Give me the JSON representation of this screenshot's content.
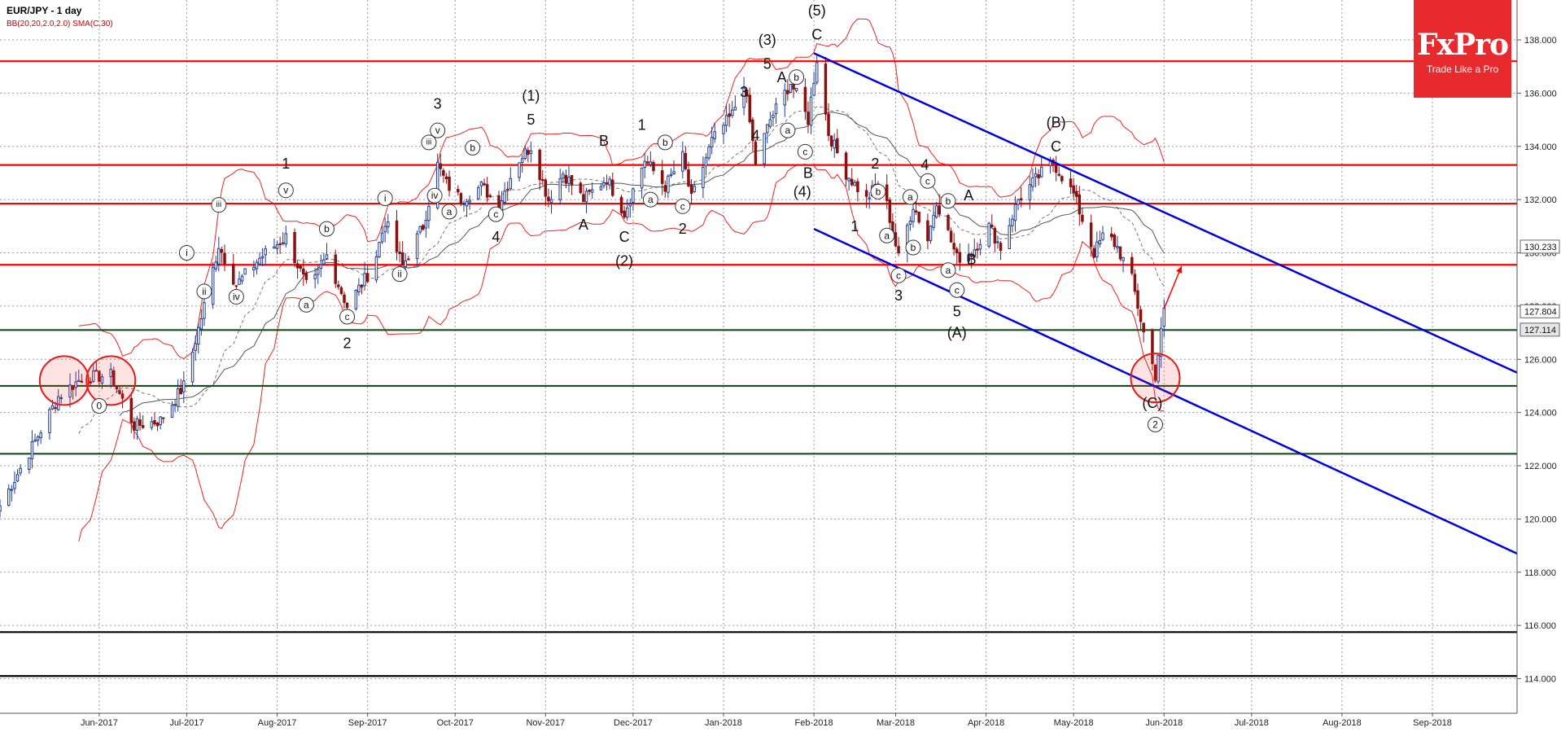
{
  "header": {
    "title": "EUR/JPY - 1 day",
    "indicators": "BB(20,20,2.0,2.0) SMA(C,30)"
  },
  "brand": {
    "name": "FxPro",
    "tagline": "Trade Like a Pro"
  },
  "chart_data": {
    "type": "candlestick",
    "symbol": "EUR/JPY",
    "timeframe": "1 day",
    "ylim": [
      112.7,
      139.5
    ],
    "y_ticks": [
      114,
      116,
      118,
      120,
      122,
      124,
      126,
      128,
      130,
      132,
      134,
      136,
      138
    ],
    "y_tick_labels": [
      "114.000",
      "116.000",
      "118.000",
      "120.000",
      "122.000",
      "124.000",
      "126.000",
      "128.000",
      "130.000",
      "132.000",
      "134.000",
      "136.000",
      "138.000"
    ],
    "x_range": [
      "2017-04-28",
      "2018-09-30"
    ],
    "x_ticks": [
      {
        "date": "2017-06-01",
        "label": "Jun-2017"
      },
      {
        "date": "2017-07-01",
        "label": "Jul-2017"
      },
      {
        "date": "2017-08-01",
        "label": "Aug-2017"
      },
      {
        "date": "2017-09-01",
        "label": "Sep-2017"
      },
      {
        "date": "2017-10-01",
        "label": "Oct-2017"
      },
      {
        "date": "2017-11-01",
        "label": "Nov-2017"
      },
      {
        "date": "2017-12-01",
        "label": "Dec-2017"
      },
      {
        "date": "2018-01-01",
        "label": "Jan-2018"
      },
      {
        "date": "2018-02-01",
        "label": "Feb-2018"
      },
      {
        "date": "2018-03-01",
        "label": "Mar-2018"
      },
      {
        "date": "2018-04-01",
        "label": "Apr-2018"
      },
      {
        "date": "2018-05-01",
        "label": "May-2018"
      },
      {
        "date": "2018-06-01",
        "label": "Jun-2018"
      },
      {
        "date": "2018-07-01",
        "label": "Jul-2018"
      },
      {
        "date": "2018-08-01",
        "label": "Aug-2018"
      },
      {
        "date": "2018-09-01",
        "label": "Sep-2018"
      }
    ],
    "price_labels": [
      {
        "value": 130.233,
        "label": "130.233",
        "color": "#ffffff"
      },
      {
        "value": 127.804,
        "label": "127.804",
        "color": "#ffffff"
      },
      {
        "value": 127.114,
        "label": "127.114",
        "color": "#e6e6e6"
      }
    ],
    "horizontal_levels": [
      {
        "value": 137.2,
        "color": "#ff0000"
      },
      {
        "value": 133.3,
        "color": "#ff0000"
      },
      {
        "value": 131.85,
        "color": "#ff0000"
      },
      {
        "value": 129.55,
        "color": "#ff0000"
      },
      {
        "value": 127.1,
        "color": "#1a4d1a"
      },
      {
        "value": 125.0,
        "color": "#1a4d1a"
      },
      {
        "value": 122.45,
        "color": "#1a4d1a"
      },
      {
        "value": 115.75,
        "color": "#000000"
      },
      {
        "value": 114.1,
        "color": "#000000"
      }
    ],
    "channel_lines": [
      {
        "from": {
          "date": "2018-02-01",
          "value": 137.5
        },
        "to": {
          "date": "2018-09-30",
          "value": 125.5
        },
        "color": "#0000dd"
      },
      {
        "from": {
          "date": "2018-02-01",
          "value": 130.9
        },
        "to": {
          "date": "2018-09-30",
          "value": 118.7
        },
        "color": "#0000dd"
      }
    ],
    "highlight_circles": [
      {
        "date": "2017-05-20",
        "value": 125.2
      },
      {
        "date": "2017-06-05",
        "value": 125.2
      },
      {
        "date": "2018-05-29",
        "value": 125.3
      }
    ],
    "projection_arrow": {
      "from": {
        "date": "2018-06-01",
        "value": 127.9
      },
      "to": {
        "date": "2018-06-07",
        "value": 129.5
      }
    },
    "price_anchors": [
      [
        "2017-04-28",
        120.5
      ],
      [
        "2017-05-08",
        122.5
      ],
      [
        "2017-05-18",
        124.6
      ],
      [
        "2017-05-26",
        125.3
      ],
      [
        "2017-06-05",
        125.4
      ],
      [
        "2017-06-13",
        123.5
      ],
      [
        "2017-06-22",
        123.7
      ],
      [
        "2017-06-30",
        125.0
      ],
      [
        "2017-07-07",
        128.0
      ],
      [
        "2017-07-12",
        130.3
      ],
      [
        "2017-07-18",
        128.8
      ],
      [
        "2017-07-26",
        129.8
      ],
      [
        "2017-08-04",
        130.6
      ],
      [
        "2017-08-12",
        128.5
      ],
      [
        "2017-08-18",
        129.9
      ],
      [
        "2017-08-25",
        128.0
      ],
      [
        "2017-09-03",
        129.5
      ],
      [
        "2017-09-07",
        131.2
      ],
      [
        "2017-09-13",
        129.5
      ],
      [
        "2017-09-20",
        131.0
      ],
      [
        "2017-09-25",
        133.3
      ],
      [
        "2017-09-28",
        132.6
      ],
      [
        "2017-10-03",
        132.0
      ],
      [
        "2017-10-10",
        132.5
      ],
      [
        "2017-10-16",
        131.8
      ],
      [
        "2017-10-22",
        133.4
      ],
      [
        "2017-10-27",
        134.0
      ],
      [
        "2017-11-02",
        132.0
      ],
      [
        "2017-11-07",
        133.0
      ],
      [
        "2017-11-14",
        132.0
      ],
      [
        "2017-11-22",
        132.8
      ],
      [
        "2017-11-28",
        131.5
      ],
      [
        "2017-12-05",
        133.5
      ],
      [
        "2017-12-12",
        132.5
      ],
      [
        "2017-12-18",
        133.6
      ],
      [
        "2017-12-21",
        132.0
      ],
      [
        "2017-12-28",
        134.2
      ],
      [
        "2018-01-04",
        135.2
      ],
      [
        "2018-01-08",
        136.4
      ],
      [
        "2018-01-12",
        133.4
      ],
      [
        "2018-01-17",
        135.0
      ],
      [
        "2018-01-24",
        136.4
      ],
      [
        "2018-01-30",
        135.0
      ],
      [
        "2018-02-02",
        137.3
      ],
      [
        "2018-02-06",
        134.5
      ],
      [
        "2018-02-12",
        133.0
      ],
      [
        "2018-02-19",
        132.0
      ],
      [
        "2018-02-24",
        132.8
      ],
      [
        "2018-03-02",
        129.8
      ],
      [
        "2018-03-07",
        131.8
      ],
      [
        "2018-03-12",
        130.5
      ],
      [
        "2018-03-15",
        132.0
      ],
      [
        "2018-03-22",
        129.8
      ],
      [
        "2018-03-27",
        130.0
      ],
      [
        "2018-04-02",
        131.0
      ],
      [
        "2018-04-06",
        130.2
      ],
      [
        "2018-04-12",
        132.0
      ],
      [
        "2018-04-20",
        133.0
      ],
      [
        "2018-04-24",
        133.4
      ],
      [
        "2018-05-01",
        132.2
      ],
      [
        "2018-05-08",
        130.0
      ],
      [
        "2018-05-12",
        130.8
      ],
      [
        "2018-05-16",
        130.2
      ],
      [
        "2018-05-21",
        129.0
      ],
      [
        "2018-05-25",
        127.0
      ],
      [
        "2018-05-29",
        125.4
      ],
      [
        "2018-06-01",
        127.8
      ]
    ],
    "wave_labels": [
      {
        "date": "2017-06-01",
        "value": 124.25,
        "text": "0",
        "circled": true
      },
      {
        "date": "2017-07-01",
        "value": 130.0,
        "text": "i",
        "circled": true
      },
      {
        "date": "2017-07-07",
        "value": 128.55,
        "text": "ii",
        "circled": true
      },
      {
        "date": "2017-07-12",
        "value": 131.8,
        "text": "iii",
        "circled": true
      },
      {
        "date": "2017-07-18",
        "value": 128.35,
        "text": "iv",
        "circled": true
      },
      {
        "date": "2017-08-04",
        "value": 132.35,
        "text": "v",
        "circled": true
      },
      {
        "date": "2017-08-04",
        "value": 133.35,
        "text": "1",
        "circled": false
      },
      {
        "date": "2017-08-11",
        "value": 128.05,
        "text": "a",
        "circled": true
      },
      {
        "date": "2017-08-18",
        "value": 130.9,
        "text": "b",
        "circled": true
      },
      {
        "date": "2017-08-25",
        "value": 127.6,
        "text": "c",
        "circled": true
      },
      {
        "date": "2017-08-25",
        "value": 126.6,
        "text": "2",
        "circled": false
      },
      {
        "date": "2017-09-07",
        "value": 132.05,
        "text": "i",
        "circled": true
      },
      {
        "date": "2017-09-12",
        "value": 129.2,
        "text": "ii",
        "circled": true
      },
      {
        "date": "2017-09-22",
        "value": 134.15,
        "text": "iii",
        "circled": true
      },
      {
        "date": "2017-09-24",
        "value": 132.15,
        "text": "iv",
        "circled": true
      },
      {
        "date": "2017-09-25",
        "value": 134.6,
        "text": "v",
        "circled": true
      },
      {
        "date": "2017-09-25",
        "value": 135.6,
        "text": "3",
        "circled": false
      },
      {
        "date": "2017-09-29",
        "value": 131.55,
        "text": "a",
        "circled": true
      },
      {
        "date": "2017-10-07",
        "value": 133.95,
        "text": "b",
        "circled": true
      },
      {
        "date": "2017-10-15",
        "value": 131.45,
        "text": "c",
        "circled": true
      },
      {
        "date": "2017-10-15",
        "value": 130.6,
        "text": "4",
        "circled": false
      },
      {
        "date": "2017-10-27",
        "value": 135.0,
        "text": "5",
        "circled": false
      },
      {
        "date": "2017-10-27",
        "value": 135.9,
        "text": "(1)",
        "circled": false
      },
      {
        "date": "2017-11-14",
        "value": 131.05,
        "text": "A",
        "circled": false
      },
      {
        "date": "2017-11-21",
        "value": 134.2,
        "text": "B",
        "circled": false
      },
      {
        "date": "2017-11-28",
        "value": 130.6,
        "text": "C",
        "circled": false
      },
      {
        "date": "2017-11-28",
        "value": 129.7,
        "text": "(2)",
        "circled": false
      },
      {
        "date": "2017-12-04",
        "value": 134.8,
        "text": "1",
        "circled": false
      },
      {
        "date": "2017-12-07",
        "value": 132.0,
        "text": "a",
        "circled": true
      },
      {
        "date": "2017-12-12",
        "value": 134.15,
        "text": "b",
        "circled": true
      },
      {
        "date": "2017-12-18",
        "value": 131.75,
        "text": "c",
        "circled": true
      },
      {
        "date": "2017-12-18",
        "value": 130.9,
        "text": "2",
        "circled": false
      },
      {
        "date": "2018-01-08",
        "value": 136.05,
        "text": "3",
        "circled": false
      },
      {
        "date": "2018-01-12",
        "value": 134.4,
        "text": "4",
        "circled": false
      },
      {
        "date": "2018-01-16",
        "value": 137.1,
        "text": "5",
        "circled": false
      },
      {
        "date": "2018-01-16",
        "value": 138.0,
        "text": "(3)",
        "circled": false
      },
      {
        "date": "2018-01-28",
        "value": 132.3,
        "text": "(4)",
        "circled": false
      },
      {
        "date": "2018-01-21",
        "value": 136.6,
        "text": "A",
        "circled": false
      },
      {
        "date": "2018-01-23",
        "value": 134.6,
        "text": "a",
        "circled": true
      },
      {
        "date": "2018-01-26",
        "value": 136.6,
        "text": "b",
        "circled": true
      },
      {
        "date": "2018-01-29",
        "value": 133.8,
        "text": "c",
        "circled": true
      },
      {
        "date": "2018-01-30",
        "value": 133.0,
        "text": "B",
        "circled": false
      },
      {
        "date": "2018-02-02",
        "value": 138.2,
        "text": "C",
        "circled": false
      },
      {
        "date": "2018-02-02",
        "value": 139.1,
        "text": "(5)",
        "circled": false
      },
      {
        "date": "2018-02-15",
        "value": 131.0,
        "text": "1",
        "circled": false
      },
      {
        "date": "2018-02-22",
        "value": 133.35,
        "text": "2",
        "circled": false
      },
      {
        "date": "2018-02-23",
        "value": 132.3,
        "text": "b",
        "circled": true
      },
      {
        "date": "2018-02-26",
        "value": 130.65,
        "text": "a",
        "circled": true
      },
      {
        "date": "2018-03-02",
        "value": 129.15,
        "text": "c",
        "circled": true
      },
      {
        "date": "2018-03-02",
        "value": 128.4,
        "text": "3",
        "circled": false
      },
      {
        "date": "2018-03-06",
        "value": 132.1,
        "text": "a",
        "circled": true
      },
      {
        "date": "2018-03-07",
        "value": 130.2,
        "text": "b",
        "circled": true
      },
      {
        "date": "2018-03-11",
        "value": 133.3,
        "text": "4",
        "circled": false
      },
      {
        "date": "2018-03-12",
        "value": 132.7,
        "text": "c",
        "circled": true
      },
      {
        "date": "2018-03-19",
        "value": 131.95,
        "text": "b",
        "circled": true
      },
      {
        "date": "2018-03-19",
        "value": 129.35,
        "text": "a",
        "circled": true
      },
      {
        "date": "2018-03-22",
        "value": 128.6,
        "text": "c",
        "circled": true
      },
      {
        "date": "2018-03-22",
        "value": 127.8,
        "text": "5",
        "circled": false
      },
      {
        "date": "2018-03-22",
        "value": 127.0,
        "text": "(A)",
        "circled": false
      },
      {
        "date": "2018-03-26",
        "value": 132.15,
        "text": "A",
        "circled": false
      },
      {
        "date": "2018-03-27",
        "value": 129.75,
        "text": "B",
        "circled": false
      },
      {
        "date": "2018-04-25",
        "value": 134.0,
        "text": "C",
        "circled": false
      },
      {
        "date": "2018-04-25",
        "value": 134.9,
        "text": "(B)",
        "circled": false
      },
      {
        "date": "2018-05-28",
        "value": 124.35,
        "text": "(C)",
        "circled": false
      },
      {
        "date": "2018-05-29",
        "value": 123.55,
        "text": "2",
        "circled": true
      }
    ]
  }
}
